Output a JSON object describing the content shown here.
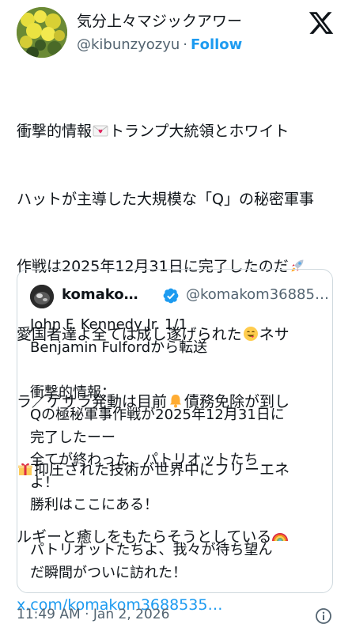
{
  "author": {
    "display_name": "気分上々マジックアワー",
    "handle": "@kibunzyozyu",
    "separator": "·",
    "follow_label": "Follow"
  },
  "brand": {
    "logo_icon": "x-logo-icon"
  },
  "tweet": {
    "lines": [
      {
        "pre": "衝撃的情報",
        "emoji": "love-letter-icon",
        "post": "トランプ大統領とホワイト"
      },
      {
        "pre": "ハットが主導した大規模な「Q」の秘密軍事",
        "emoji": "",
        "post": ""
      },
      {
        "pre": "作戦は2025年12月31日に完了したのだ",
        "emoji": "rocket-icon",
        "post": ""
      },
      {
        "pre": "愛国者達よ全ては成し遂げられた",
        "emoji": "smiling-face-icon",
        "post": "ネサ"
      },
      {
        "pre": "ラ／ゲサラ発動は目前",
        "emoji": "bell-icon",
        "post": "債務免除が到し"
      },
      {
        "pre": "",
        "emoji": "gift-icon",
        "post": "抑圧された技術が世界中にフリーエネ"
      },
      {
        "pre": "ルギーと癒しをもたらそうとしている",
        "emoji": "rainbow-icon",
        "post": ""
      }
    ],
    "link_text": "x.com/komakom3688535…"
  },
  "quote": {
    "name": "komako…",
    "handle": "@komakom36885…",
    "verified_icon": "verified-badge-icon",
    "lines": [
      "John F. Kennedy Jr.   1/1",
      "Benjamin Fulfordから転送",
      "",
      "衝撃的情報：",
      "Qの極秘軍事作戦が2025年12月31日に",
      "完了したーー",
      "全てが終わった、パトリオットたち",
      "よ！",
      "勝利はここにある！",
      "",
      "パトリオットたちよ、我々が待ち望ん",
      "だ瞬間がついに訪れた！"
    ]
  },
  "meta": {
    "timestamp": "11:49 AM · Jan 2, 2026",
    "info_icon": "info-icon"
  },
  "colors": {
    "accent": "#1d9bf0",
    "text": "#0f1419",
    "secondary": "#536471",
    "border": "#cfd9de"
  }
}
